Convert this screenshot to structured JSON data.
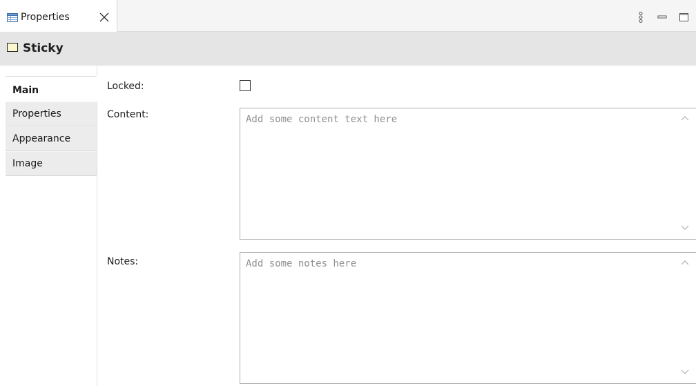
{
  "view_tab": {
    "label": "Properties",
    "icon": "properties-table-icon",
    "close_icon": "close-icon"
  },
  "toolbar": {
    "menu_icon": "view-menu-icon",
    "minimize_icon": "minimize-icon",
    "maximize_icon": "maximize-icon"
  },
  "header": {
    "icon": "sticky-note-icon",
    "title": "Sticky"
  },
  "sections": [
    {
      "label": "Main",
      "active": true
    },
    {
      "label": "Properties",
      "active": false
    },
    {
      "label": "Appearance",
      "active": false
    },
    {
      "label": "Image",
      "active": false
    }
  ],
  "form": {
    "locked": {
      "label": "Locked:",
      "checked": false
    },
    "content": {
      "label": "Content:",
      "value": "",
      "placeholder": "Add some content text here"
    },
    "notes": {
      "label": "Notes:",
      "value": "",
      "placeholder": "Add some notes here"
    }
  },
  "colors": {
    "header_bg": "#e5e5e5",
    "tabbar_bg": "#f5f5f5",
    "sticky_fill": "#fbf7cf",
    "inactive_tab_bg": "#ececec"
  }
}
